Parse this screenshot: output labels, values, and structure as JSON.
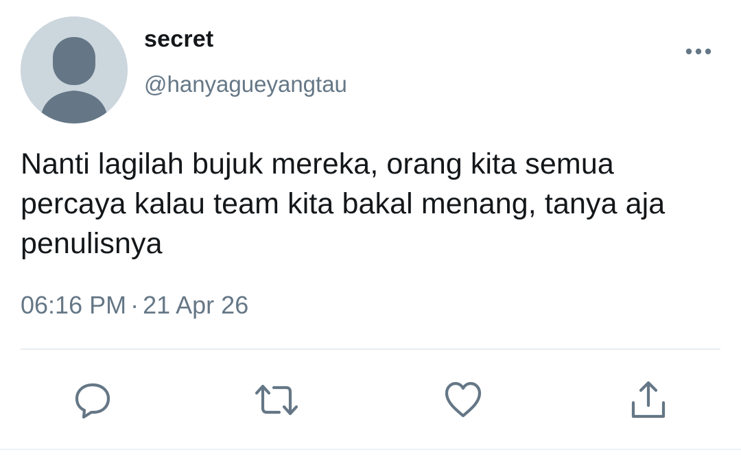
{
  "user": {
    "display_name": "secret",
    "handle": "@hanyagueyangtau",
    "avatar_icon": "default-avatar-icon"
  },
  "tweet": {
    "text": "Nanti lagilah bujuk mereka, orang kita semua percaya kalau team kita bakal menang, tanya aja penulisnya",
    "time": "06:16 PM",
    "separator": "·",
    "date": "21 Apr 26"
  },
  "actions": {
    "reply_icon": "reply-icon",
    "retweet_icon": "retweet-icon",
    "like_icon": "heart-icon",
    "share_icon": "share-icon",
    "more_icon": "more-icon"
  },
  "colors": {
    "text": "#14171a",
    "secondary": "#657786",
    "avatar_bg": "#ccd6dd",
    "avatar_fg": "#657786",
    "icon": "#657786",
    "divider": "#e6ecf0"
  }
}
